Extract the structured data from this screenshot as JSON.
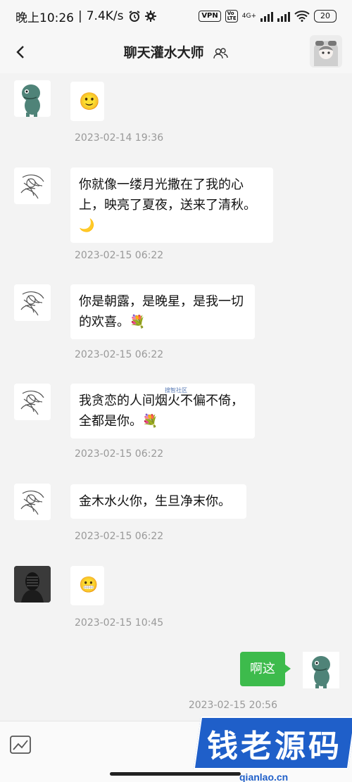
{
  "status_bar": {
    "time": "晚上10:26",
    "speed": "7.4K/s",
    "vpn": "VPN",
    "volte": "Vo LTE",
    "network": "4G+",
    "battery": "20"
  },
  "header": {
    "title": "聊天灌水大师"
  },
  "messages": [
    {
      "text": "🙂",
      "time": "2023-02-14 19:36"
    },
    {
      "text": "你就像一缕月光撒在了我的心上，映亮了夏夜，送来了清秋。🌙",
      "time": "2023-02-15 06:22"
    },
    {
      "text": "你是朝露，是晚星，是我一切的欢喜。💐",
      "time": "2023-02-15 06:22"
    },
    {
      "text": "我贪恋的人间烟火不偏不倚，全都是你。💐",
      "time": "2023-02-15 06:22"
    },
    {
      "text": "金木水火你，生旦净末你。",
      "time": "2023-02-15 06:22"
    },
    {
      "text": "😬",
      "time": "2023-02-15 10:45"
    }
  ],
  "sent": {
    "text": "啊这",
    "time": "2023-02-15 20:56"
  },
  "watermark": {
    "tiny": "搜智社区",
    "brand": "钱老源码",
    "url": "qianlao.cn"
  },
  "colors": {
    "sent_bubble": "#3dbb4c",
    "brand": "#1f5fc9"
  }
}
